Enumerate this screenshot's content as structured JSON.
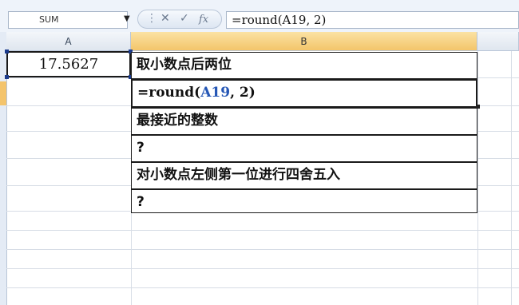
{
  "name_box": {
    "value": "SUM"
  },
  "formula_bar": {
    "buttons": [
      "cancel-icon",
      "enter-icon",
      "function-icon"
    ],
    "formula_text": "=round(A19, 2)"
  },
  "columns": [
    {
      "label": "A"
    },
    {
      "label": "B"
    }
  ],
  "cells": {
    "a1": "17.5627",
    "b_rows": [
      {
        "text": "取小数点后两位"
      },
      {
        "text_prefix": "=round(",
        "text_ref": "A19",
        "text_suffix": ", 2)"
      },
      {
        "text": "最接近的整数"
      },
      {
        "text": "?"
      },
      {
        "text": "对小数点左侧第一位进行四舍五入"
      },
      {
        "text": "?"
      }
    ]
  },
  "colors": {
    "active_header": "#f3c56a",
    "reference_blue": "#2456b5"
  }
}
